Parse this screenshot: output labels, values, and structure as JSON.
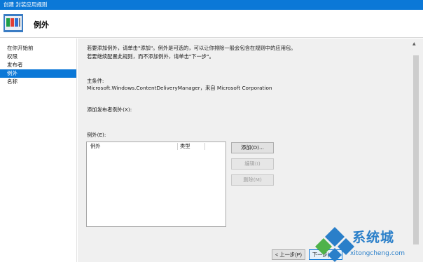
{
  "window": {
    "title": "创建 封装应用规则"
  },
  "header": {
    "title": "例外"
  },
  "sidebar": {
    "items": [
      {
        "label": "在你开始前",
        "active": false
      },
      {
        "label": "权限",
        "active": false
      },
      {
        "label": "发布者",
        "active": false
      },
      {
        "label": "例外",
        "active": true
      },
      {
        "label": "名称",
        "active": false
      }
    ]
  },
  "main": {
    "description": "若要添加例外，请单击\"添加\"。例外是可选的，可以让你排除一般会包含在规则中的应用包。若要继续配置此规则，而不添加例外，请单击\"下一步\"。",
    "condition_label": "主条件:",
    "condition_value": "Microsoft.Windows.ContentDeliveryManager，来自 Microsoft Corporation",
    "publisher_exceptions_label": "添加发布者例外(X):",
    "exceptions_label": "例外(E):",
    "list_columns": [
      "例外",
      "类型"
    ],
    "add_button": "添加(D)...",
    "edit_button": "编辑(I)",
    "delete_button": "删除(M)"
  },
  "footer": {
    "prev_button": "< 上一步(P)",
    "next_button": "下一步(N) >"
  },
  "watermark": {
    "text": "系统城",
    "sub": "xitongcheng.com"
  },
  "colors": {
    "accent": "#0b78d7",
    "panel": "#f0f0f0"
  }
}
